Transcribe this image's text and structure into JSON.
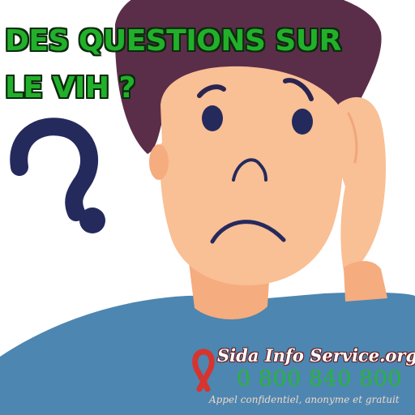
{
  "headline": {
    "line1": "DES QUESTIONS SUR",
    "line2": "LE VIH ?"
  },
  "logo": {
    "name": "Sida Info Service.org",
    "phone": "0 800 840 800",
    "tagline": "Appel confidentiel, anonyme et gratuit"
  },
  "colors": {
    "headline": "#22b02a",
    "hair": "#5a2e48",
    "skin": "#f9bf95",
    "shirt": "#4d86b0",
    "question_mark": "#252a5c",
    "ribbon": "#d6342f"
  },
  "icons": [
    "question-mark-icon",
    "red-ribbon-icon"
  ]
}
